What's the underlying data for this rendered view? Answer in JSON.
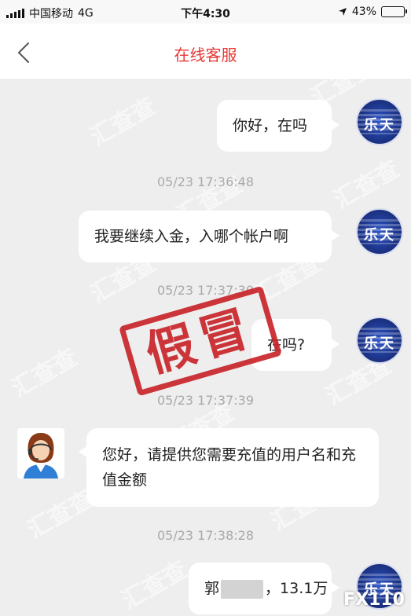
{
  "status_bar": {
    "carrier": "中国移动",
    "network": "4G",
    "time": "下午4:30",
    "battery": "43%",
    "battery_level": 0.43
  },
  "header": {
    "title": "在线客服"
  },
  "avatars": {
    "user_text": "乐天"
  },
  "messages": [
    {
      "sender": "user",
      "text": "你好，在吗"
    },
    {
      "sender": "user",
      "text": "我要继续入金，入哪个帐户啊"
    },
    {
      "sender": "user",
      "text": "在吗?"
    },
    {
      "sender": "agent",
      "text": "您好，请提供您需要充值的用户名和充值金额"
    },
    {
      "sender": "user",
      "text_prefix": "郭",
      "text_suffix": "，13.1万"
    }
  ],
  "timestamps": [
    "05/23 17:36:48",
    "05/23 17:37:30",
    "05/23 17:37:39",
    "05/23 17:38:28"
  ],
  "stamp_text": "假冒",
  "watermark_text": "汇查查",
  "corner_logo": "FX110",
  "colors": {
    "accent_red": "#e53935",
    "stamp_red": "#c9262b",
    "avatar_blue": "#1a2f7e",
    "chat_background": "#eeeeee"
  }
}
